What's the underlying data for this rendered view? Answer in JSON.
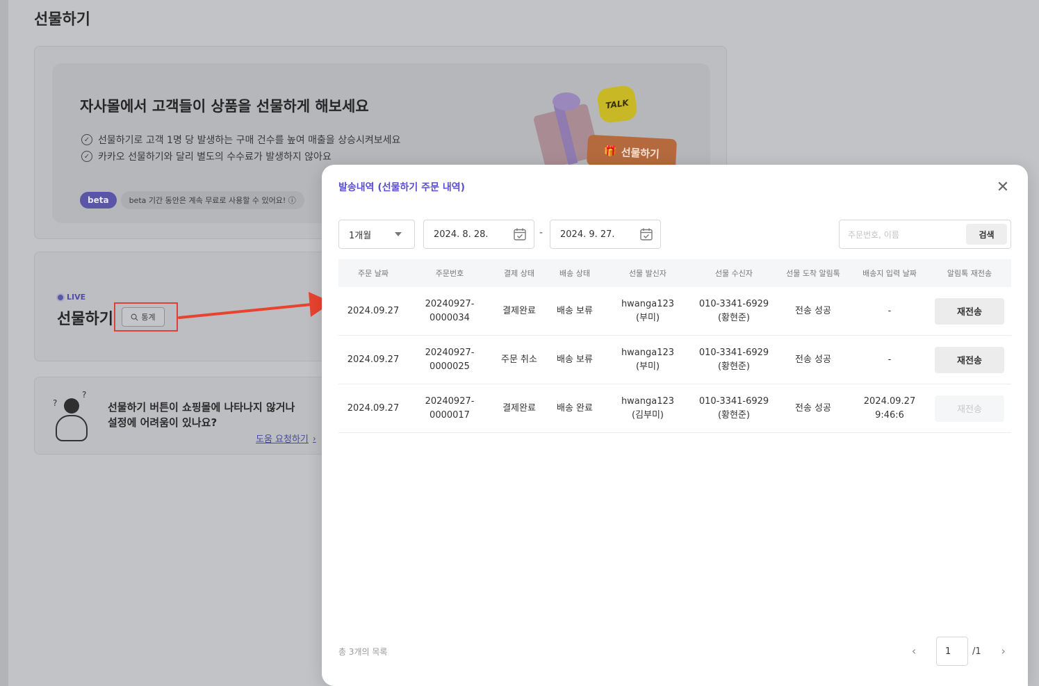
{
  "page": {
    "title": "선물하기"
  },
  "promo": {
    "headline": "자사몰에서 고객들이 상품을 선물하게 해보세요",
    "bullets": [
      "선물하기로 고객 1명 당 발생하는 구매 건수를 높여 매출을 상승시켜보세요",
      "카카오 선물하기와 달리 별도의 수수료가 발생하지 않아요"
    ],
    "beta_badge": "beta",
    "beta_note": "beta 기간 동안은 계속 무료로 사용할 수 있어요! ⓘ",
    "talk_label": "TALK",
    "gift_button_label": "선물하기"
  },
  "live_card": {
    "tag": "LIVE",
    "title": "선물하기",
    "stats_label": "통계"
  },
  "help_card": {
    "line1": "선물하기 버튼이 쇼핑몰에 나타나지 않거나",
    "line2": "설정에 어려움이 있나요?",
    "link": "도움 요청하기"
  },
  "modal": {
    "title": "발송내역 (선물하기 주문 내역)",
    "period": "1개월",
    "date_from": "2024. 8. 28.",
    "date_to": "2024. 9. 27.",
    "date_separator": "-",
    "search_placeholder": "주문번호, 이름",
    "search_button": "검색",
    "columns": [
      "주문 날짜",
      "주문번호",
      "결제 상태",
      "배송 상태",
      "선물 발신자",
      "선물 수신자",
      "선물 도착 알림톡",
      "배송지 입력 날짜",
      "알림톡 재전송"
    ],
    "rows": [
      {
        "date": "2024.09.27",
        "order_no_1": "20240927-",
        "order_no_2": "0000034",
        "payment": "결제완료",
        "shipping": "배송 보류",
        "sender_1": "hwanga123",
        "sender_2": "(부미)",
        "receiver_1": "010-3341-6929",
        "receiver_2": "(황현준)",
        "notify": "전송 성공",
        "address_date_1": "-",
        "address_date_2": "",
        "resend": "재전송",
        "resend_enabled": true
      },
      {
        "date": "2024.09.27",
        "order_no_1": "20240927-",
        "order_no_2": "0000025",
        "payment": "주문 취소",
        "shipping": "배송 보류",
        "sender_1": "hwanga123",
        "sender_2": "(부미)",
        "receiver_1": "010-3341-6929",
        "receiver_2": "(황현준)",
        "notify": "전송 성공",
        "address_date_1": "-",
        "address_date_2": "",
        "resend": "재전송",
        "resend_enabled": true
      },
      {
        "date": "2024.09.27",
        "order_no_1": "20240927-",
        "order_no_2": "0000017",
        "payment": "결제완료",
        "shipping": "배송 완료",
        "sender_1": "hwanga123",
        "sender_2": "(김부미)",
        "receiver_1": "010-3341-6929",
        "receiver_2": "(황현준)",
        "notify": "전송 성공",
        "address_date_1": "2024.09.27",
        "address_date_2": "9:46:6",
        "resend": "재전송",
        "resend_enabled": false
      }
    ],
    "total_text": "총 3개의 목록",
    "page_current": "1",
    "page_total": "/1"
  },
  "colors": {
    "accent": "#5b4fd0",
    "highlight": "#e0403a"
  }
}
